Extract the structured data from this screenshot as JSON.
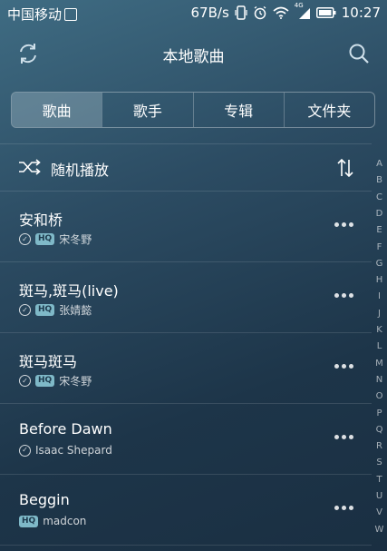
{
  "status_bar": {
    "carrier": "中国移动",
    "speed": "67B/s",
    "network": "4G",
    "battery": "",
    "time": "10:27"
  },
  "header": {
    "title": "本地歌曲",
    "refresh_icon": "refresh-icon",
    "search_icon": "search-icon"
  },
  "tabs": [
    {
      "label": "歌曲",
      "active": true
    },
    {
      "label": "歌手",
      "active": false
    },
    {
      "label": "专辑",
      "active": false
    },
    {
      "label": "文件夹",
      "active": false
    }
  ],
  "shuffle": {
    "label": "随机播放",
    "icon": "shuffle-icon",
    "sort_icon": "sort-icon"
  },
  "songs": [
    {
      "title": "安和桥",
      "artist": "宋冬野",
      "downloaded": true,
      "hq": true
    },
    {
      "title": "斑马,斑马(live)",
      "artist": "张婧懿",
      "downloaded": true,
      "hq": true
    },
    {
      "title": "斑马斑马",
      "artist": "宋冬野",
      "downloaded": true,
      "hq": true
    },
    {
      "title": "Before Dawn",
      "artist": "Isaac Shepard",
      "downloaded": true,
      "hq": false
    },
    {
      "title": "Beggin",
      "artist": "madcon",
      "downloaded": false,
      "hq": true
    }
  ],
  "hq_badge": "HQ",
  "alphabet": [
    "A",
    "B",
    "C",
    "D",
    "E",
    "F",
    "G",
    "H",
    "I",
    "J",
    "K",
    "L",
    "M",
    "N",
    "O",
    "P",
    "Q",
    "R",
    "S",
    "T",
    "U",
    "V",
    "W"
  ],
  "colors": {
    "hq_badge": "#7fb9c8",
    "background_top": "#3f6c83",
    "background_bottom": "#1a2f42"
  }
}
